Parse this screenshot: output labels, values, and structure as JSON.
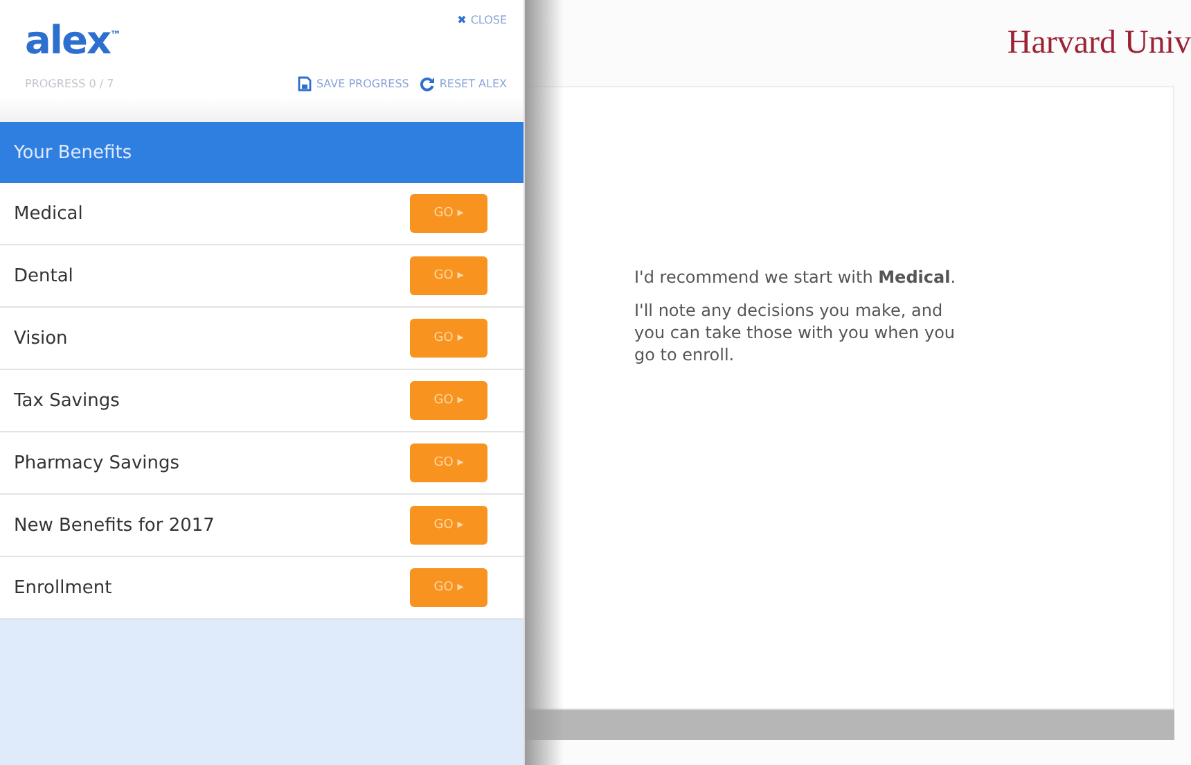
{
  "sidebar": {
    "logo": "alex",
    "logo_mark": "™",
    "close": {
      "icon": "✖",
      "label": "CLOSE"
    },
    "progress": "PROGRESS 0 / 7",
    "save": "SAVE PROGRESS",
    "reset": "RESET ALEX",
    "section": "Your Benefits",
    "items": [
      {
        "label": "Medical",
        "button": "GO ▸"
      },
      {
        "label": "Dental",
        "button": "GO ▸"
      },
      {
        "label": "Vision",
        "button": "GO ▸"
      },
      {
        "label": "Tax Savings",
        "button": "GO ▸"
      },
      {
        "label": "Pharmacy Savings",
        "button": "GO ▸"
      },
      {
        "label": "New Benefits for 2017",
        "button": "GO ▸"
      },
      {
        "label": "Enrollment",
        "button": "GO ▸"
      }
    ]
  },
  "page": {
    "title": "Harvard Univ",
    "messages": [
      "I'd recommend we start with **Medical**.",
      "I'll note any decisions you make, and you can take those with you when you go to enroll."
    ]
  }
}
